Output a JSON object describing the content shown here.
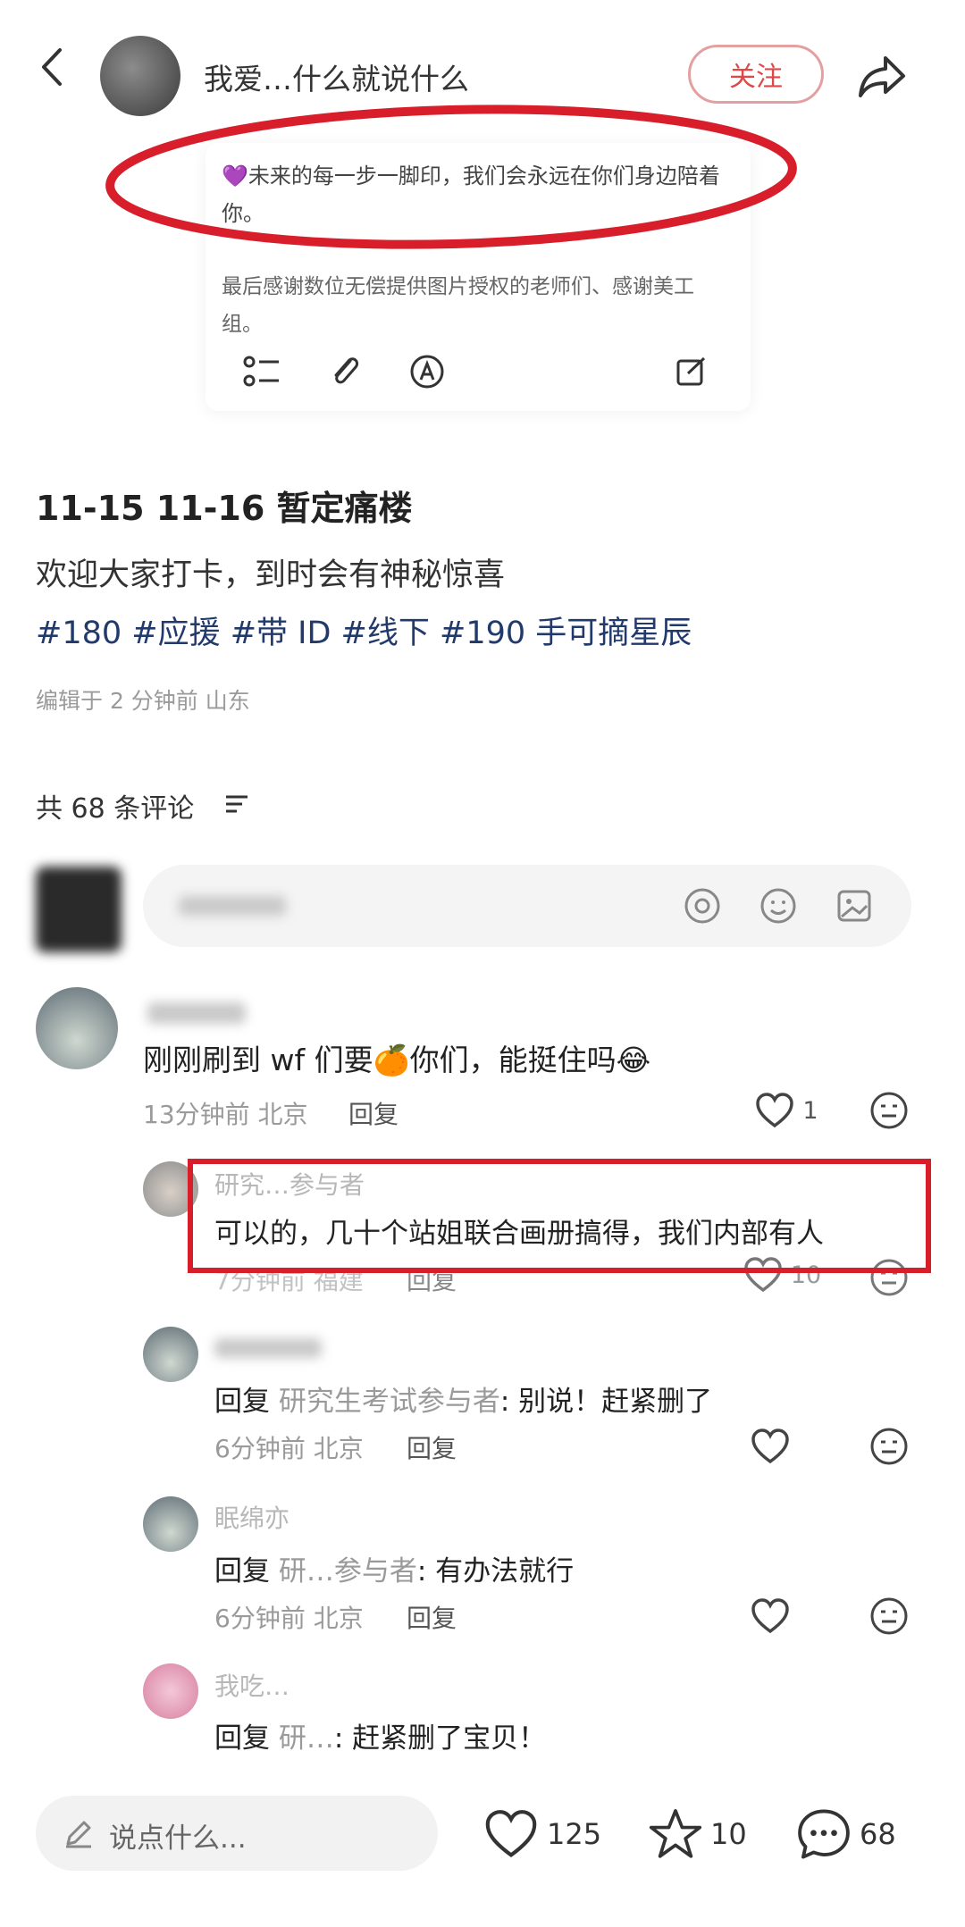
{
  "header": {
    "author_name": "我爱…什么就说什么",
    "follow_label": "关注"
  },
  "note_preview": {
    "line1": "💜未来的每一步一脚印，我们会永远在你们身边陪着你。",
    "line2": "最后感谢数位无偿提供图片授权的老师们、感谢美工组。"
  },
  "post": {
    "title": "11-15 11-16 暂定痛楼",
    "body": "欢迎大家打卡，到时会有神秘惊喜",
    "tags": "#180 #应援 #带 ID #线下 #190 手可摘星辰",
    "meta": "编辑于 2 分钟前 山东"
  },
  "comments_header": {
    "count_label": "共 68 条评论"
  },
  "comments": [
    {
      "text": "刚刚刷到 wf 们要🍊你们，能挺住吗😂",
      "time": "13分钟前 北京",
      "reply_label": "回复",
      "likes": "1"
    }
  ],
  "replies": [
    {
      "name": "研究…参与者",
      "text": "可以的，几十个站姐联合画册搞得，我们内部有人",
      "time": "7分钟前 福建",
      "reply_label": "回复",
      "likes": "10"
    },
    {
      "prefix": "回复",
      "target": "研究生考试参与者",
      "text": ": 别说！赶紧删了",
      "time": "6分钟前 北京",
      "reply_label": "回复"
    },
    {
      "name": "眠绵亦",
      "prefix": "回复",
      "target": "研…参与者",
      "text": ": 有办法就行",
      "time": "6分钟前 北京",
      "reply_label": "回复"
    },
    {
      "name": "我吃…",
      "prefix": "回复",
      "target": "研…",
      "text": ": 赶紧删了宝贝！"
    }
  ],
  "bottom_bar": {
    "input_placeholder": "说点什么...",
    "likes": "125",
    "stars": "10",
    "comments": "68"
  },
  "colors": {
    "highlight_red": "#d81e2b",
    "follow_red": "#e04848",
    "tag_blue": "#223a6b"
  }
}
